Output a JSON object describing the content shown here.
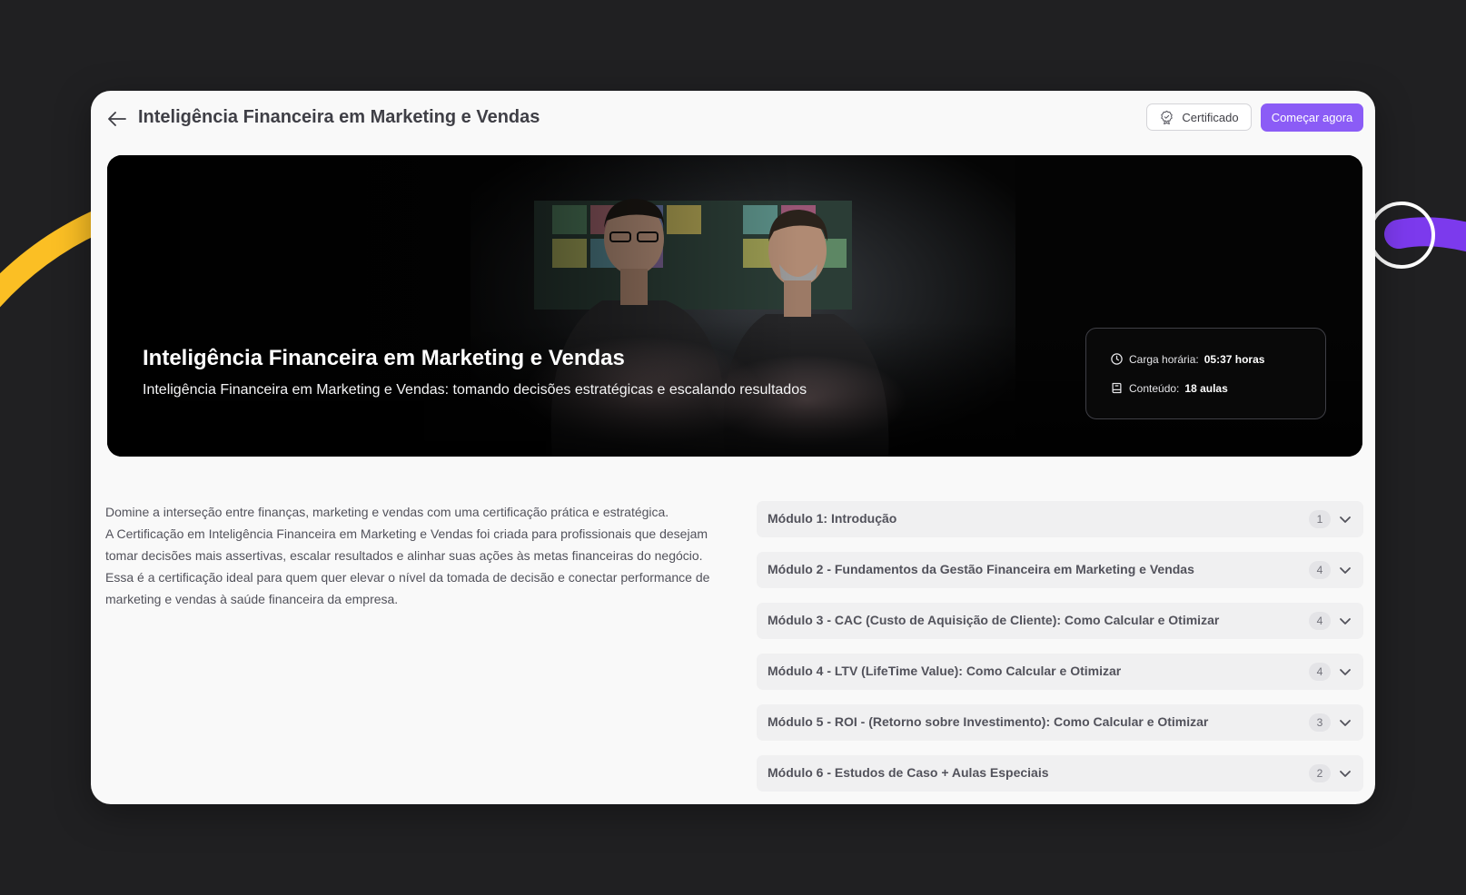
{
  "header": {
    "title": "Inteligência Financeira em Marketing e Vendas",
    "certificate_label": "Certificado",
    "start_label": "Começar agora"
  },
  "hero": {
    "title": "Inteligência Financeira em Marketing e Vendas",
    "subtitle": "Inteligência Financeira em Marketing e Vendas: tomando decisões estratégicas e escalando resultados",
    "workload_label": "Carga horária:",
    "workload_value": "05:37 horas",
    "content_label": "Conteúdo:",
    "content_value": "18 aulas"
  },
  "description": [
    "Domine a interseção entre finanças, marketing e vendas com uma certificação prática e estratégica.",
    "A Certificação em Inteligência Financeira em Marketing e Vendas foi criada para profissionais que desejam tomar decisões mais assertivas, escalar resultados e alinhar suas ações às metas financeiras do negócio. Essa é a certificação ideal para quem quer elevar o nível da tomada de decisão e conectar performance de marketing e vendas à saúde financeira da empresa."
  ],
  "modules": [
    {
      "title": "Módulo 1: Introdução",
      "count": "1"
    },
    {
      "title": "Módulo 2 - Fundamentos da Gestão Financeira em Marketing e Vendas",
      "count": "4"
    },
    {
      "title": "Módulo 3 - CAC (Custo de Aquisição de Cliente): Como Calcular e Otimizar",
      "count": "4"
    },
    {
      "title": "Módulo 4 - LTV (LifeTime Value): Como Calcular e Otimizar",
      "count": "4"
    },
    {
      "title": "Módulo 5 - ROI - (Retorno sobre Investimento): Como Calcular e Otimizar",
      "count": "3"
    },
    {
      "title": "Módulo 6 - Estudos de Caso + Aulas Especiais",
      "count": "2"
    }
  ],
  "colors": {
    "background": "#202022",
    "card": "#f9f9f9",
    "accent": "#8b5cf6",
    "deco_yellow": "#fbbf24",
    "deco_purple": "#7c3aed"
  },
  "icons": {
    "back": "arrow-left-icon",
    "certificate": "certificate-badge-icon",
    "workload": "clock-icon",
    "content": "book-icon",
    "module_toggle": "chevron-down-icon"
  }
}
